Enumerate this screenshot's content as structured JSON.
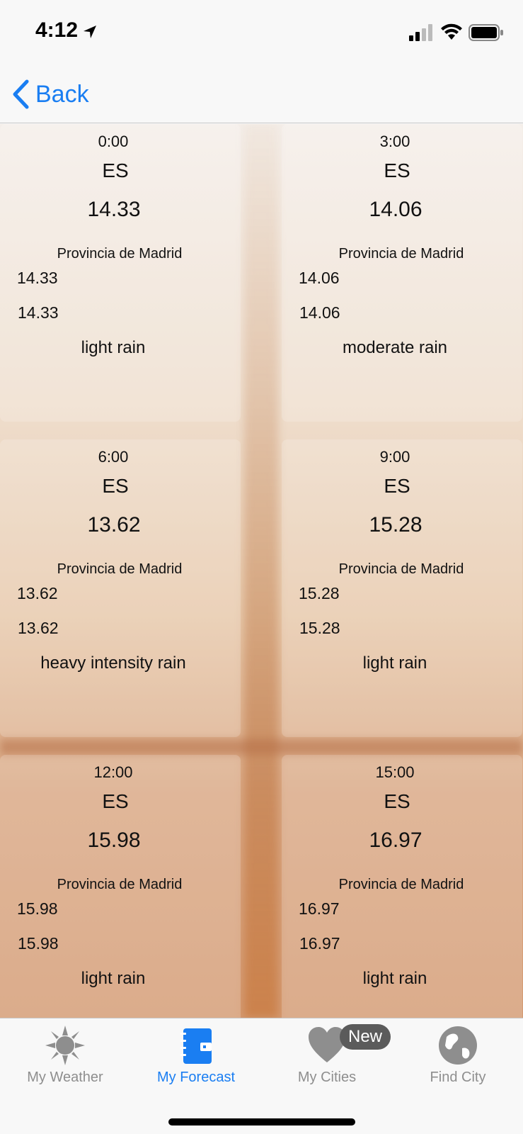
{
  "status_bar": {
    "time": "4:12"
  },
  "nav": {
    "back_label": "Back"
  },
  "forecasts": [
    {
      "time": "0:00",
      "country": "ES",
      "temp": "14.33",
      "region": "Provincia de Madrid",
      "temp_min": "14.33",
      "temp_max": "14.33",
      "description": "light rain"
    },
    {
      "time": "3:00",
      "country": "ES",
      "temp": "14.06",
      "region": "Provincia de Madrid",
      "temp_min": "14.06",
      "temp_max": "14.06",
      "description": "moderate rain"
    },
    {
      "time": "6:00",
      "country": "ES",
      "temp": "13.62",
      "region": "Provincia de Madrid",
      "temp_min": "13.62",
      "temp_max": "13.62",
      "description": "heavy intensity rain"
    },
    {
      "time": "9:00",
      "country": "ES",
      "temp": "15.28",
      "region": "Provincia de Madrid",
      "temp_min": "15.28",
      "temp_max": "15.28",
      "description": "light rain"
    },
    {
      "time": "12:00",
      "country": "ES",
      "temp": "15.98",
      "region": "Provincia de Madrid",
      "temp_min": "15.98",
      "temp_max": "15.98",
      "description": "light rain"
    },
    {
      "time": "15:00",
      "country": "ES",
      "temp": "16.97",
      "region": "Provincia de Madrid",
      "temp_min": "16.97",
      "temp_max": "16.97",
      "description": "light rain"
    }
  ],
  "tab_bar": {
    "tabs": [
      {
        "label": "My Weather",
        "icon": "sun-icon",
        "active": false
      },
      {
        "label": "My Forecast",
        "icon": "notebook-icon",
        "active": true
      },
      {
        "label": "My Cities",
        "icon": "heart-icon",
        "active": false
      },
      {
        "label": "Find City",
        "icon": "globe-icon",
        "active": false
      }
    ],
    "badge": "New"
  },
  "colors": {
    "accent": "#1a7ef2",
    "inactive": "#8e8e8e"
  }
}
